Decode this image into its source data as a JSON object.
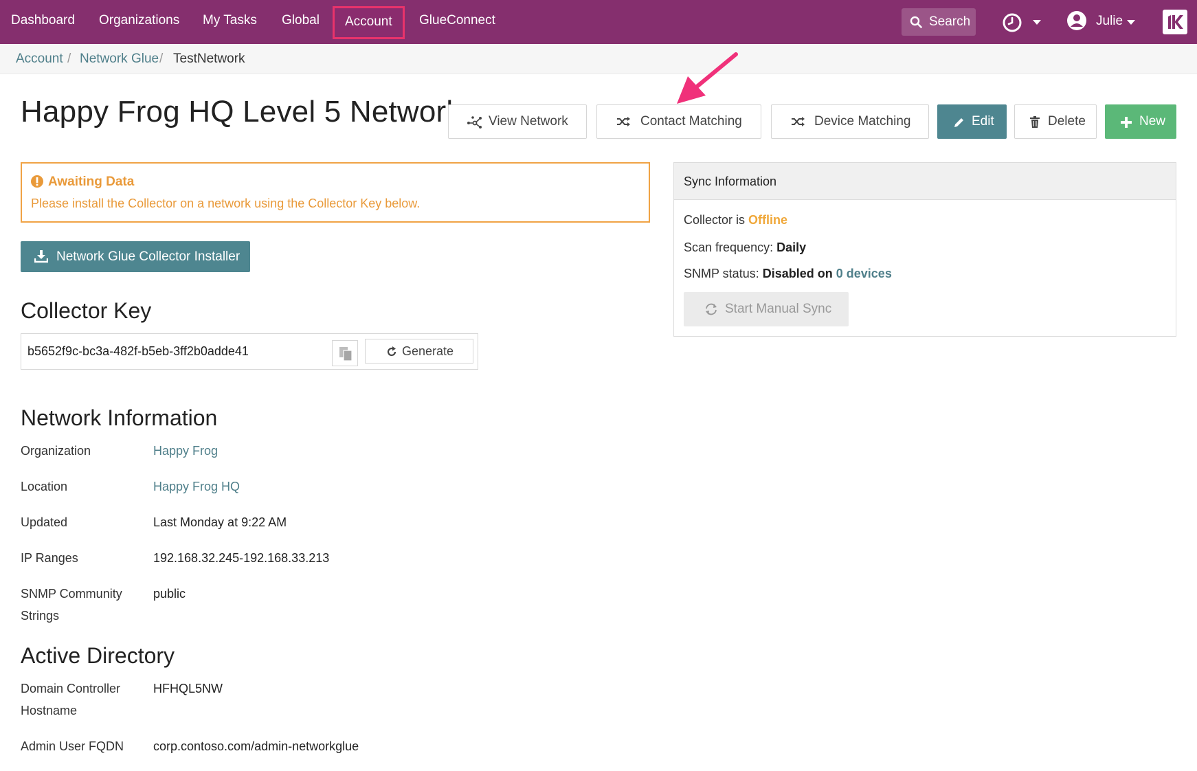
{
  "nav": {
    "items": [
      {
        "label": "Dashboard"
      },
      {
        "label": "Organizations"
      },
      {
        "label": "My Tasks"
      },
      {
        "label": "Global"
      },
      {
        "label": "Account"
      },
      {
        "label": "GlueConnect"
      }
    ],
    "search_label": "Search",
    "user_name": "Julie"
  },
  "breadcrumb": {
    "items": [
      "Account",
      "Network Glue",
      "TestNetwork"
    ],
    "separator": "/"
  },
  "page": {
    "title": "Happy Frog HQ Level 5 Network"
  },
  "actions": {
    "view_network": "View Network",
    "contact_matching": "Contact Matching",
    "device_matching": "Device Matching",
    "edit": "Edit",
    "delete": "Delete",
    "new": "New"
  },
  "alert": {
    "title": "Awaiting Data",
    "message": "Please install the Collector on a network using the Collector Key below."
  },
  "installer": {
    "label": "Network Glue Collector Installer"
  },
  "collector_key": {
    "heading": "Collector Key",
    "value": "b5652f9c-bc3a-482f-b5eb-3ff2b0adde41",
    "generate_label": "Generate"
  },
  "network_info": {
    "heading": "Network Information",
    "rows": [
      {
        "label": "Organization",
        "value": "Happy Frog"
      },
      {
        "label": "Location",
        "value": "Happy Frog HQ"
      },
      {
        "label": "Updated",
        "value": "Last Monday at 9:22 AM"
      },
      {
        "label": "IP Ranges",
        "value": "192.168.32.245-192.168.33.213"
      },
      {
        "label_line1": "SNMP Community",
        "label_line2": "Strings",
        "value": "public"
      }
    ]
  },
  "active_directory": {
    "heading": "Active Directory",
    "rows": [
      {
        "label_line1": "Domain Controller",
        "label_line2": "Hostname",
        "value": "HFHQL5NW"
      },
      {
        "label": "Admin User FQDN",
        "value": "corp.contoso.com/admin-networkglue"
      }
    ]
  },
  "sync": {
    "heading": "Sync Information",
    "collector_prefix": "Collector is",
    "collector_status": "Offline",
    "scan_prefix": "Scan frequency:",
    "scan_value": "Daily",
    "snmp_prefix": "SNMP status:",
    "snmp_value": "Disabled on",
    "snmp_devices": "0 devices",
    "manual_sync_label": "Start Manual Sync"
  },
  "colors": {
    "nav_bg": "#852f6e",
    "accent_teal": "#4e8690",
    "accent_green": "#5bb878",
    "warning": "#f0a345",
    "highlight": "#e8336b"
  },
  "icons": [
    "search-icon",
    "clock-icon",
    "user-icon",
    "brand-logo-icon",
    "network-icon",
    "shuffle-icon",
    "pencil-icon",
    "trash-icon",
    "plus-icon",
    "alert-icon",
    "download-icon",
    "copy-icon",
    "refresh-icon",
    "sync-icon"
  ]
}
